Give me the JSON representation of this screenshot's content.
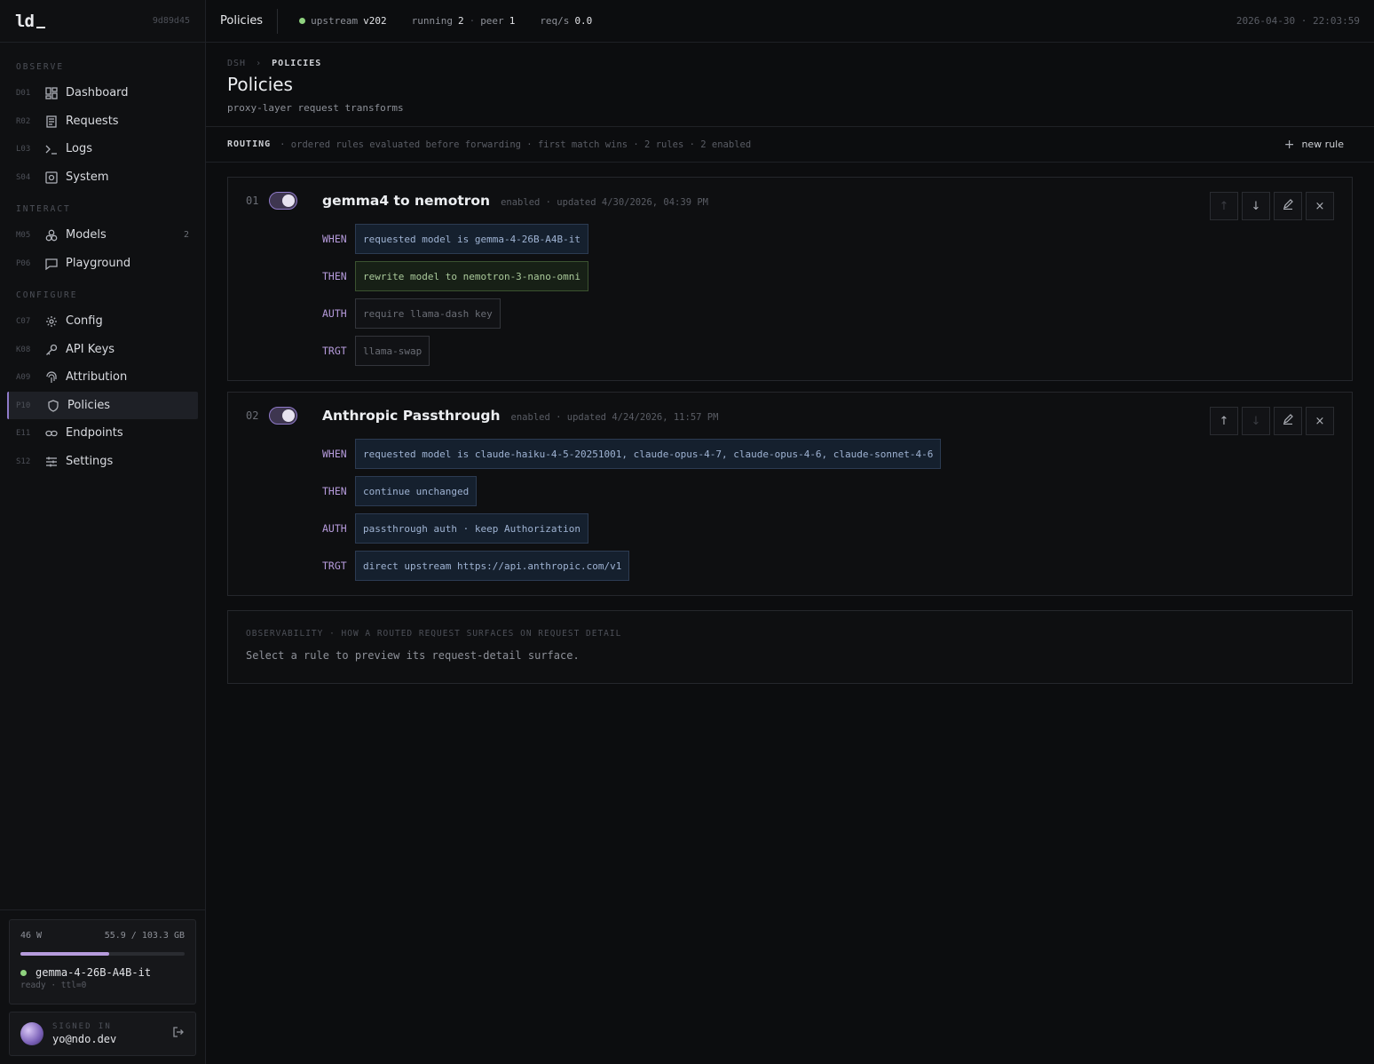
{
  "brand": {
    "logo": "ld",
    "hash": "9d89d45"
  },
  "sidebar": {
    "sections": [
      {
        "label": "OBSERVE"
      },
      {
        "label": "INTERACT"
      },
      {
        "label": "CONFIGURE"
      }
    ],
    "items": [
      {
        "code": "D01",
        "label": "Dashboard",
        "icon": "dashboard-icon"
      },
      {
        "code": "R02",
        "label": "Requests",
        "icon": "requests-icon"
      },
      {
        "code": "L03",
        "label": "Logs",
        "icon": "terminal-icon"
      },
      {
        "code": "S04",
        "label": "System",
        "icon": "system-icon"
      },
      {
        "code": "M05",
        "label": "Models",
        "icon": "models-icon",
        "count": "2"
      },
      {
        "code": "P06",
        "label": "Playground",
        "icon": "chat-icon"
      },
      {
        "code": "C07",
        "label": "Config",
        "icon": "gear-icon"
      },
      {
        "code": "K08",
        "label": "API Keys",
        "icon": "key-icon"
      },
      {
        "code": "A09",
        "label": "Attribution",
        "icon": "fingerprint-icon"
      },
      {
        "code": "P10",
        "label": "Policies",
        "icon": "shield-icon",
        "active": true
      },
      {
        "code": "E11",
        "label": "Endpoints",
        "icon": "link-icon"
      },
      {
        "code": "S12",
        "label": "Settings",
        "icon": "sliders-icon"
      }
    ]
  },
  "gpu": {
    "power": "46 W",
    "memory": "55.9 / 103.3 GB",
    "usage_fraction": 0.541,
    "model": "gemma-4-26B-A4B-it",
    "status": "ready · ttl=0"
  },
  "user": {
    "signed_label": "SIGNED IN",
    "email": "yo@ndo.dev"
  },
  "topbar": {
    "title": "Policies",
    "upstream_label": "upstream",
    "upstream_version": "v202",
    "running_label": "running",
    "running_value": "2",
    "peer_label": "peer",
    "peer_value": "1",
    "reqs_label": "req/s",
    "reqs_value": "0.0",
    "timestamp": "2026-04-30 · 22:03:59"
  },
  "header": {
    "crumb_root": "DSH",
    "crumb_sep": "›",
    "crumb_current": "POLICIES",
    "title": "Policies",
    "subtitle": "proxy-layer request transforms"
  },
  "routing": {
    "label": "ROUTING",
    "desc": "· ordered rules evaluated before forwarding · first match wins · 2 rules · 2 enabled",
    "new_rule": "new rule"
  },
  "rules": [
    {
      "num": "01",
      "name": "gemma4 to nemotron",
      "meta": "enabled · updated 4/30/2026, 04:39 PM",
      "when_key": "WHEN",
      "when": "requested model is gemma-4-26B-A4B-it",
      "then_key": "THEN",
      "then": "rewrite model to nemotron-3-nano-omni",
      "auth_key": "AUTH",
      "auth": "require llama-dash key",
      "trgt_key": "TRGT",
      "trgt": "llama-swap"
    },
    {
      "num": "02",
      "name": "Anthropic Passthrough",
      "meta": "enabled · updated 4/24/2026, 11:57 PM",
      "when_key": "WHEN",
      "when": "requested model is claude-haiku-4-5-20251001, claude-opus-4-7, claude-opus-4-6, claude-sonnet-4-6",
      "then_key": "THEN",
      "then": "continue unchanged",
      "auth_key": "AUTH",
      "auth": "passthrough auth · keep Authorization",
      "trgt_key": "TRGT",
      "trgt": "direct upstream https://api.anthropic.com/v1"
    }
  ],
  "observability": {
    "title": "OBSERVABILITY · HOW A ROUTED REQUEST SURFACES ON REQUEST DETAIL",
    "text": "Select a rule to preview its request-detail surface."
  }
}
